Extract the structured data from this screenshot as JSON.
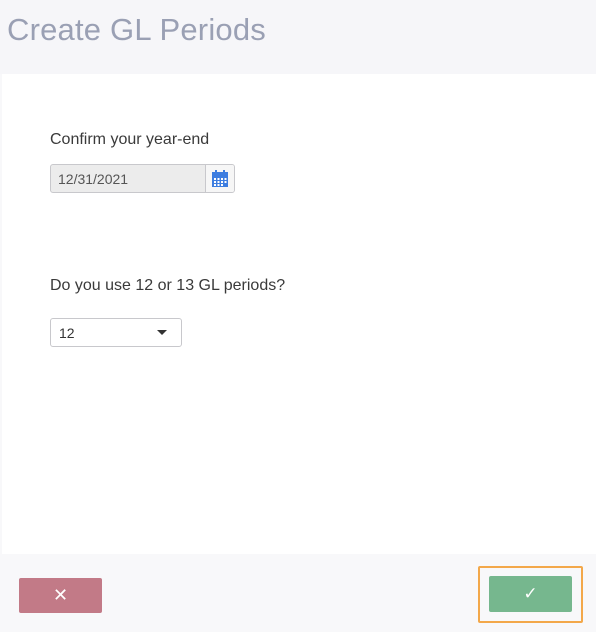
{
  "page": {
    "title": "Create GL Periods"
  },
  "year_end": {
    "label": "Confirm your year-end",
    "value": "12/31/2021",
    "calendar_icon": "calendar-icon"
  },
  "periods": {
    "label": "Do you use 12 or 13 GL periods?",
    "selected": "12",
    "dropdown_icon": "caret-down-icon"
  },
  "footer": {
    "cancel_glyph": "✕",
    "confirm_glyph": "✓",
    "colors": {
      "cancel": "#c27a87",
      "confirm": "#76b78e",
      "focus_ring": "#f3a84a"
    }
  }
}
